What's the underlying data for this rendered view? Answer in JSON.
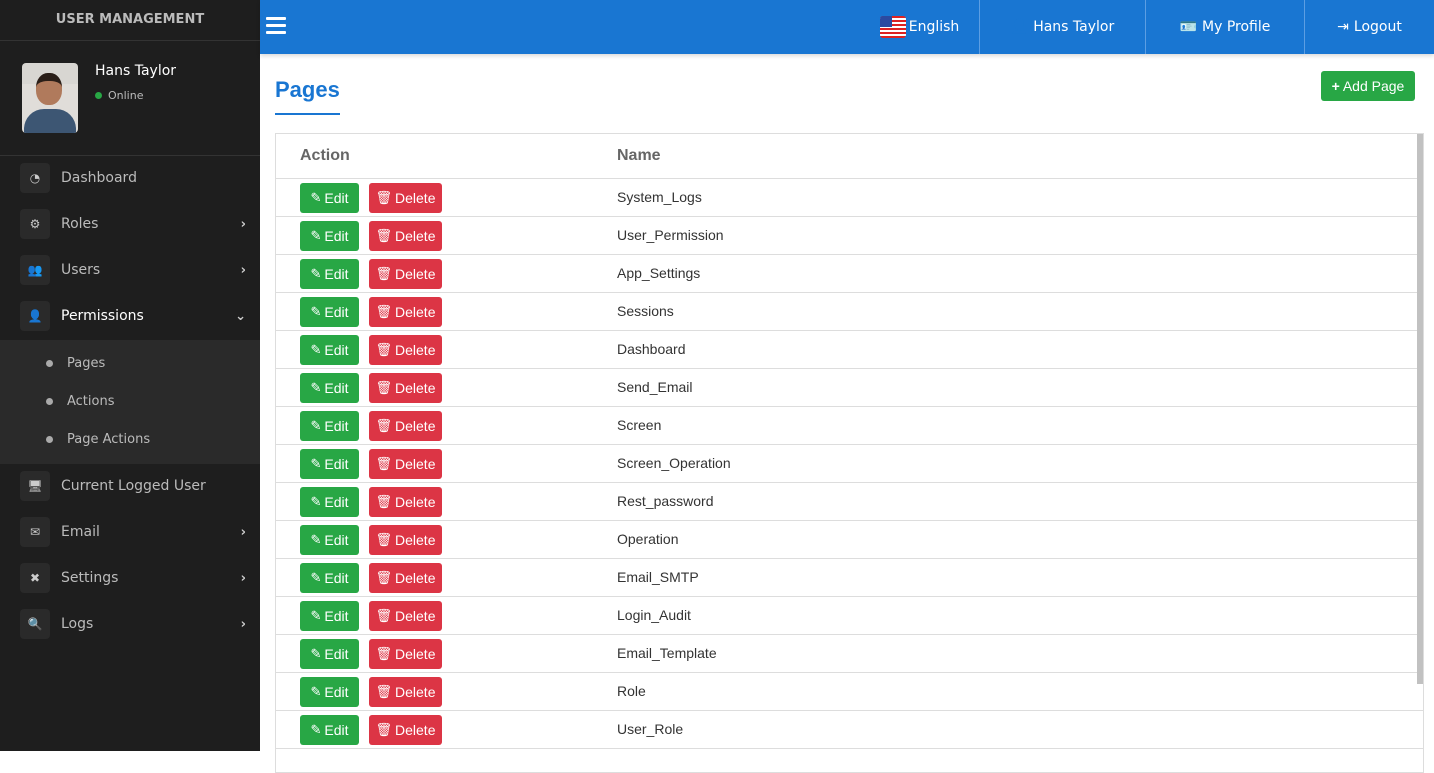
{
  "sidebar": {
    "brand": "USER MANAGEMENT",
    "user": {
      "name": "Hans Taylor",
      "status": "Online"
    },
    "items": [
      {
        "label": "Dashboard"
      },
      {
        "label": "Roles"
      },
      {
        "label": "Users"
      },
      {
        "label": "Permissions"
      }
    ],
    "submenu": [
      {
        "label": "Pages"
      },
      {
        "label": "Actions"
      },
      {
        "label": "Page Actions"
      }
    ],
    "items2": [
      {
        "label": "Current Logged User"
      },
      {
        "label": "Email"
      },
      {
        "label": "Settings"
      },
      {
        "label": "Logs"
      }
    ]
  },
  "topbar": {
    "language": "English",
    "user": "Hans Taylor",
    "profile": "My Profile",
    "logout": "Logout"
  },
  "page": {
    "title": "Pages",
    "add_label": "Add Page"
  },
  "table": {
    "headers": [
      "Action",
      "Name"
    ],
    "edit_label": "Edit",
    "delete_label": "Delete",
    "rows": [
      "System_Logs",
      "User_Permission",
      "App_Settings",
      "Sessions",
      "Dashboard",
      "Send_Email",
      "Screen",
      "Screen_Operation",
      "Rest_password",
      "Operation",
      "Email_SMTP",
      "Login_Audit",
      "Email_Template",
      "Role",
      "User_Role"
    ]
  }
}
